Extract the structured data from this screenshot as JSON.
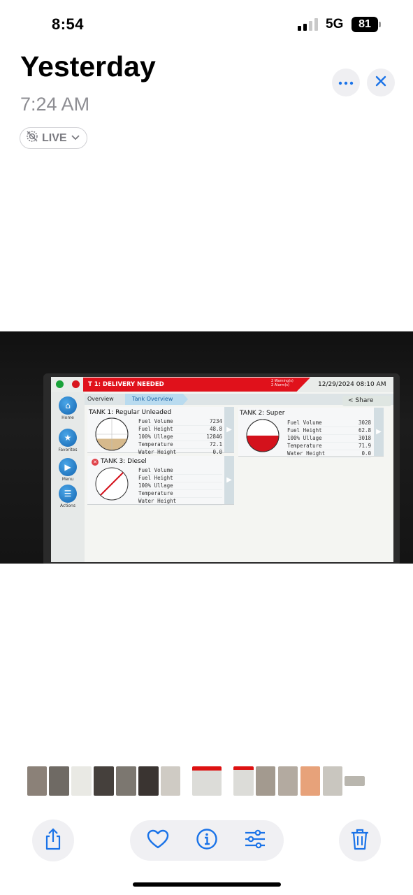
{
  "status_bar": {
    "time": "8:54",
    "network": "5G",
    "battery": "81"
  },
  "header": {
    "title": "Yesterday",
    "subtitle": "7:24 AM",
    "live_label": "LIVE",
    "more_icon": "ellipsis-icon",
    "close_icon": "close-icon"
  },
  "device_screen": {
    "alert": "T 1: DELIVERY NEEDED",
    "warnings": "2 Warning(s)",
    "alarms": "2 Alarm(s)",
    "datetime": "12/29/2024 08:10 AM",
    "tabs": [
      "Overview",
      "Tank Overview"
    ],
    "share_label": "Share",
    "nav": [
      {
        "label": "Home",
        "icon": "home-icon"
      },
      {
        "label": "Favorites",
        "icon": "star-icon"
      },
      {
        "label": "Menu",
        "icon": "tag-icon"
      },
      {
        "label": "Actions",
        "icon": "list-icon"
      }
    ],
    "tanks": [
      {
        "title": "TANK 1: Regular Unleaded",
        "fill_fraction": 0.36,
        "fill_color": "#d6b98c",
        "rows": [
          {
            "label": "Fuel Volume",
            "value": "7234"
          },
          {
            "label": "Fuel Height",
            "value": "48.8"
          },
          {
            "label": "100% Ullage",
            "value": "12846"
          },
          {
            "label": "Temperature",
            "value": "72.1"
          },
          {
            "label": "Water Height",
            "value": "0.0"
          }
        ]
      },
      {
        "title": "TANK 2: Super",
        "fill_fraction": 0.5,
        "fill_color": "#d4121c",
        "rows": [
          {
            "label": "Fuel Volume",
            "value": "3028"
          },
          {
            "label": "Fuel Height",
            "value": "62.8"
          },
          {
            "label": "100% Ullage",
            "value": "3018"
          },
          {
            "label": "Temperature",
            "value": "71.9"
          },
          {
            "label": "Water Height",
            "value": "0.0"
          }
        ]
      },
      {
        "title": "TANK 3: Diesel",
        "status_icon": "error-x-icon",
        "rows": [
          {
            "label": "Fuel Volume",
            "value": ""
          },
          {
            "label": "Fuel Height",
            "value": ""
          },
          {
            "label": "100% Ullage",
            "value": ""
          },
          {
            "label": "Temperature",
            "value": ""
          },
          {
            "label": "Water Height",
            "value": ""
          }
        ]
      }
    ]
  },
  "toolbar": {
    "share_icon": "share-icon",
    "favorite_icon": "heart-icon",
    "info_icon": "info-icon",
    "adjust_icon": "sliders-icon",
    "delete_icon": "trash-icon"
  },
  "accent_color": "#1a73e8"
}
